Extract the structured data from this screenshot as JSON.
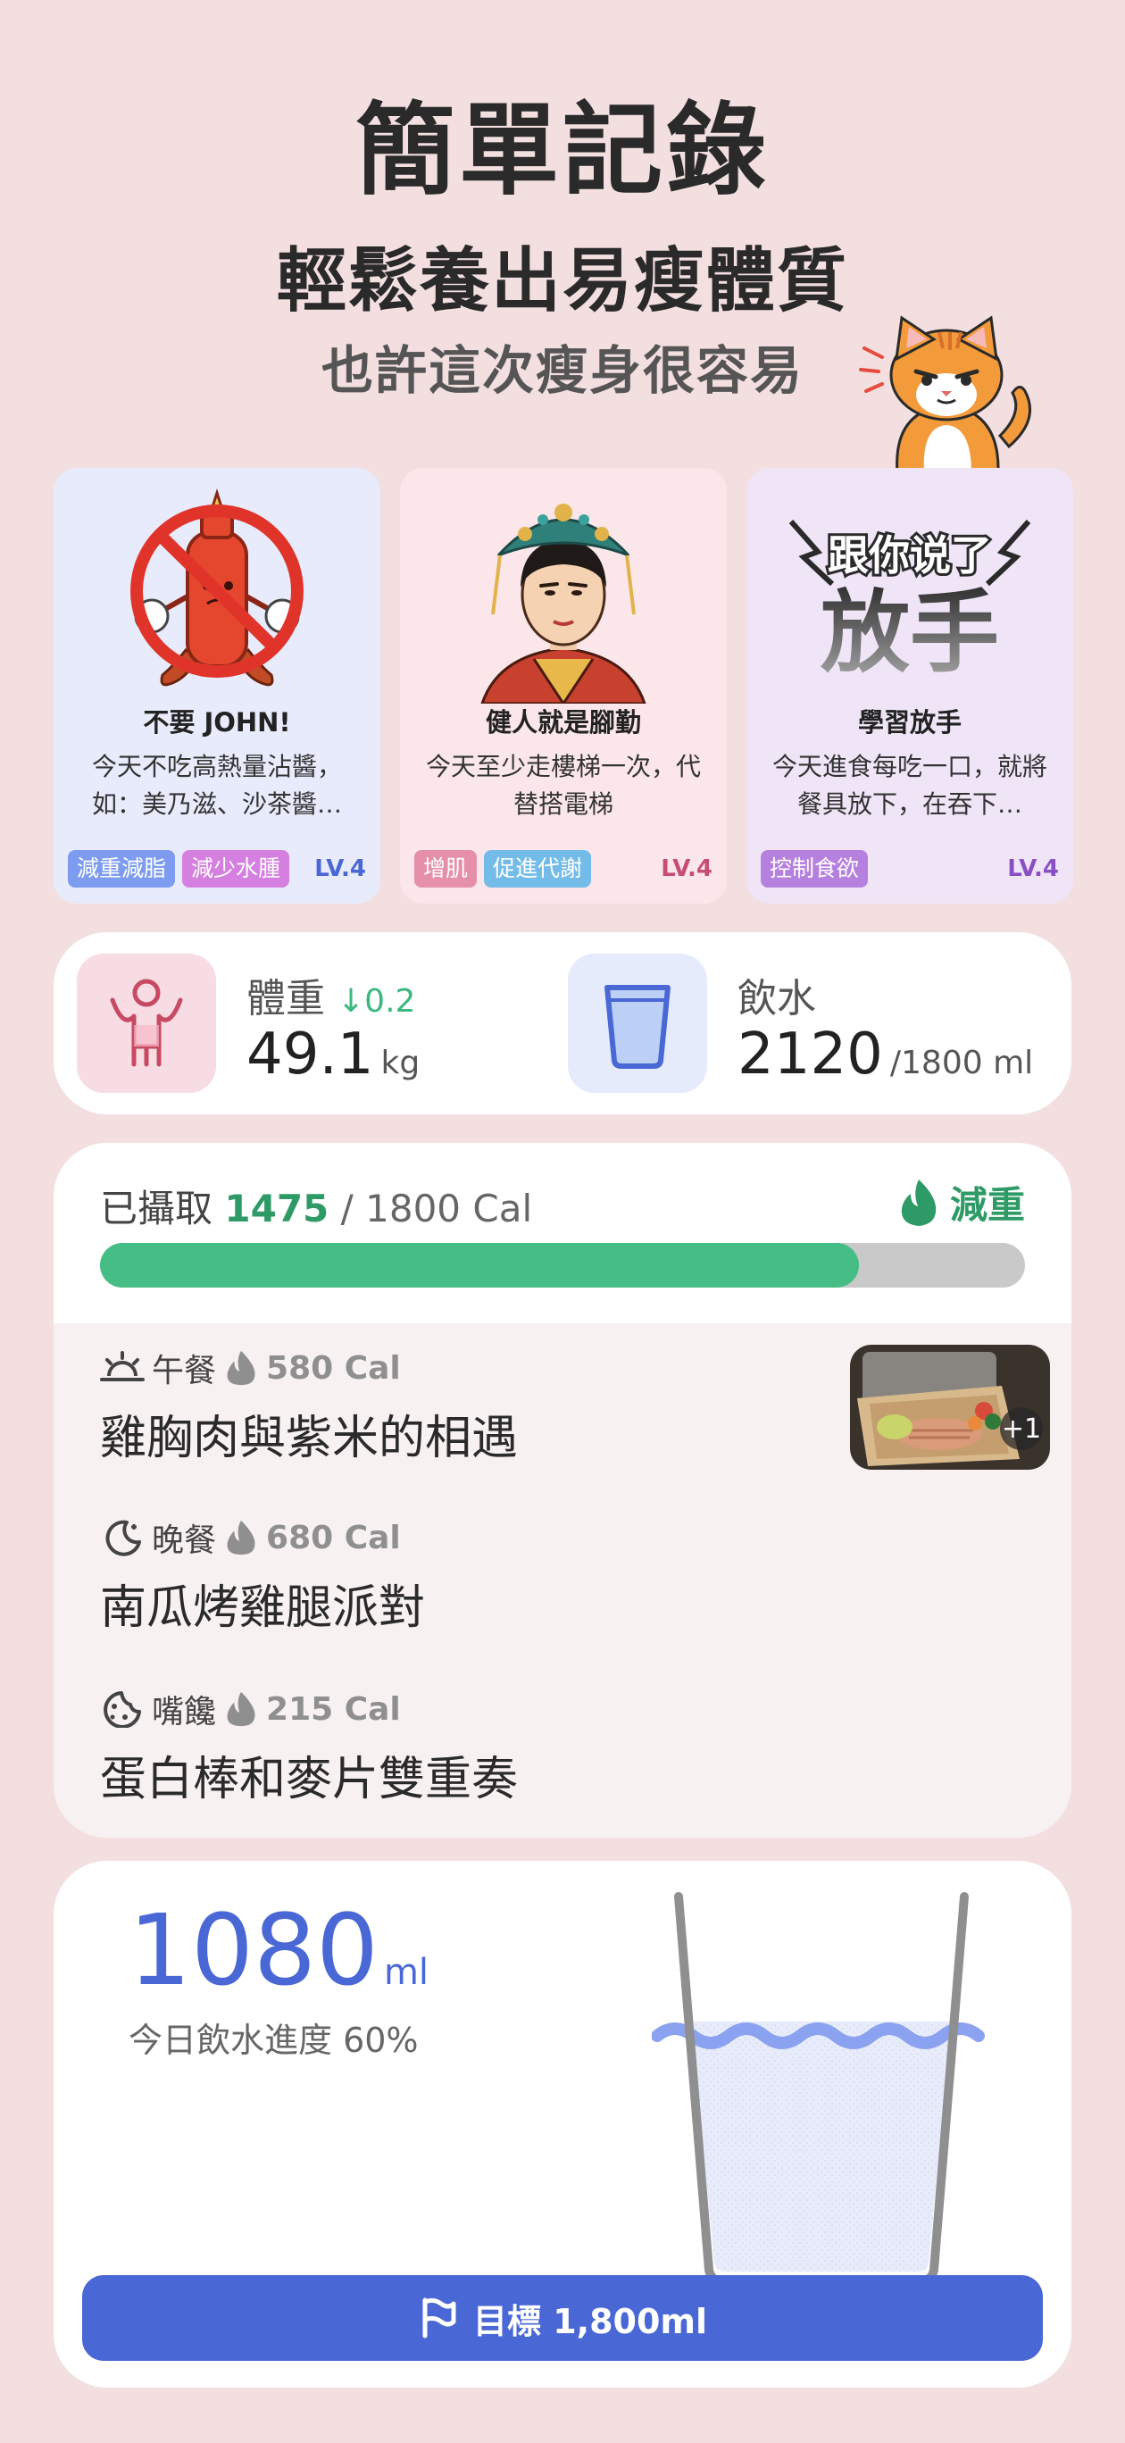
{
  "header": {
    "title": "簡單記錄",
    "subtitle": "輕鬆養出易瘦體質",
    "tagline": "也許這次瘦身很容易"
  },
  "cards": [
    {
      "title": "不要 JOHN!",
      "desc": "今天不吃高熱量沾醬，如：美乃滋、沙茶醬…",
      "tags": [
        {
          "label": "減重減脂",
          "color": "#7d9cf0"
        },
        {
          "label": "減少水腫",
          "color": "#d57fe0"
        }
      ],
      "level": "LV.4",
      "level_color": "#4a67d6",
      "bg": "#e8ebfb"
    },
    {
      "title": "健人就是腳勤",
      "desc": "今天至少走樓梯一次，代替搭電梯",
      "tags": [
        {
          "label": "增肌",
          "color": "#e58fa8"
        },
        {
          "label": "促進代謝",
          "color": "#73bbe8"
        }
      ],
      "level": "LV.4",
      "level_color": "#c64e73",
      "bg": "#fbe7ea"
    },
    {
      "title": "學習放手",
      "desc": "今天進食每吃一口，就將餐具放下，在吞下…",
      "illus_text_top": "跟你说了",
      "illus_text_main": "放手",
      "tags": [
        {
          "label": "控制食欲",
          "color": "#b580de"
        }
      ],
      "level": "LV.4",
      "level_color": "#8a4fc4",
      "bg": "#efe5f7"
    }
  ],
  "stats": {
    "weight": {
      "label": "體重",
      "delta": "0.2",
      "value": "49.1",
      "unit": "kg"
    },
    "water": {
      "label": "飲水",
      "value": "2120",
      "unit": "/1800 ml"
    }
  },
  "calories": {
    "prefix": "已攝取",
    "consumed": "1475",
    "total": "/ 1800 Cal",
    "progress": 0.82,
    "goal_label": "減重",
    "meals": [
      {
        "type": "午餐",
        "kcal": "580 Cal",
        "name": "雞胸肉與紫米的相遇",
        "icon": "sunrise-icon",
        "photo_extra": "+1"
      },
      {
        "type": "晚餐",
        "kcal": "680 Cal",
        "name": "南瓜烤雞腿派對",
        "icon": "moon-icon"
      },
      {
        "type": "嘴饞",
        "kcal": "215 Cal",
        "name": "蛋白棒和麥片雙重奏",
        "icon": "cookie-icon"
      }
    ]
  },
  "water_today": {
    "amount": "1080",
    "unit": "ml",
    "progress_label": "今日飲水進度 60%",
    "progress": 0.6,
    "goal_button": "目標 1,800ml"
  }
}
